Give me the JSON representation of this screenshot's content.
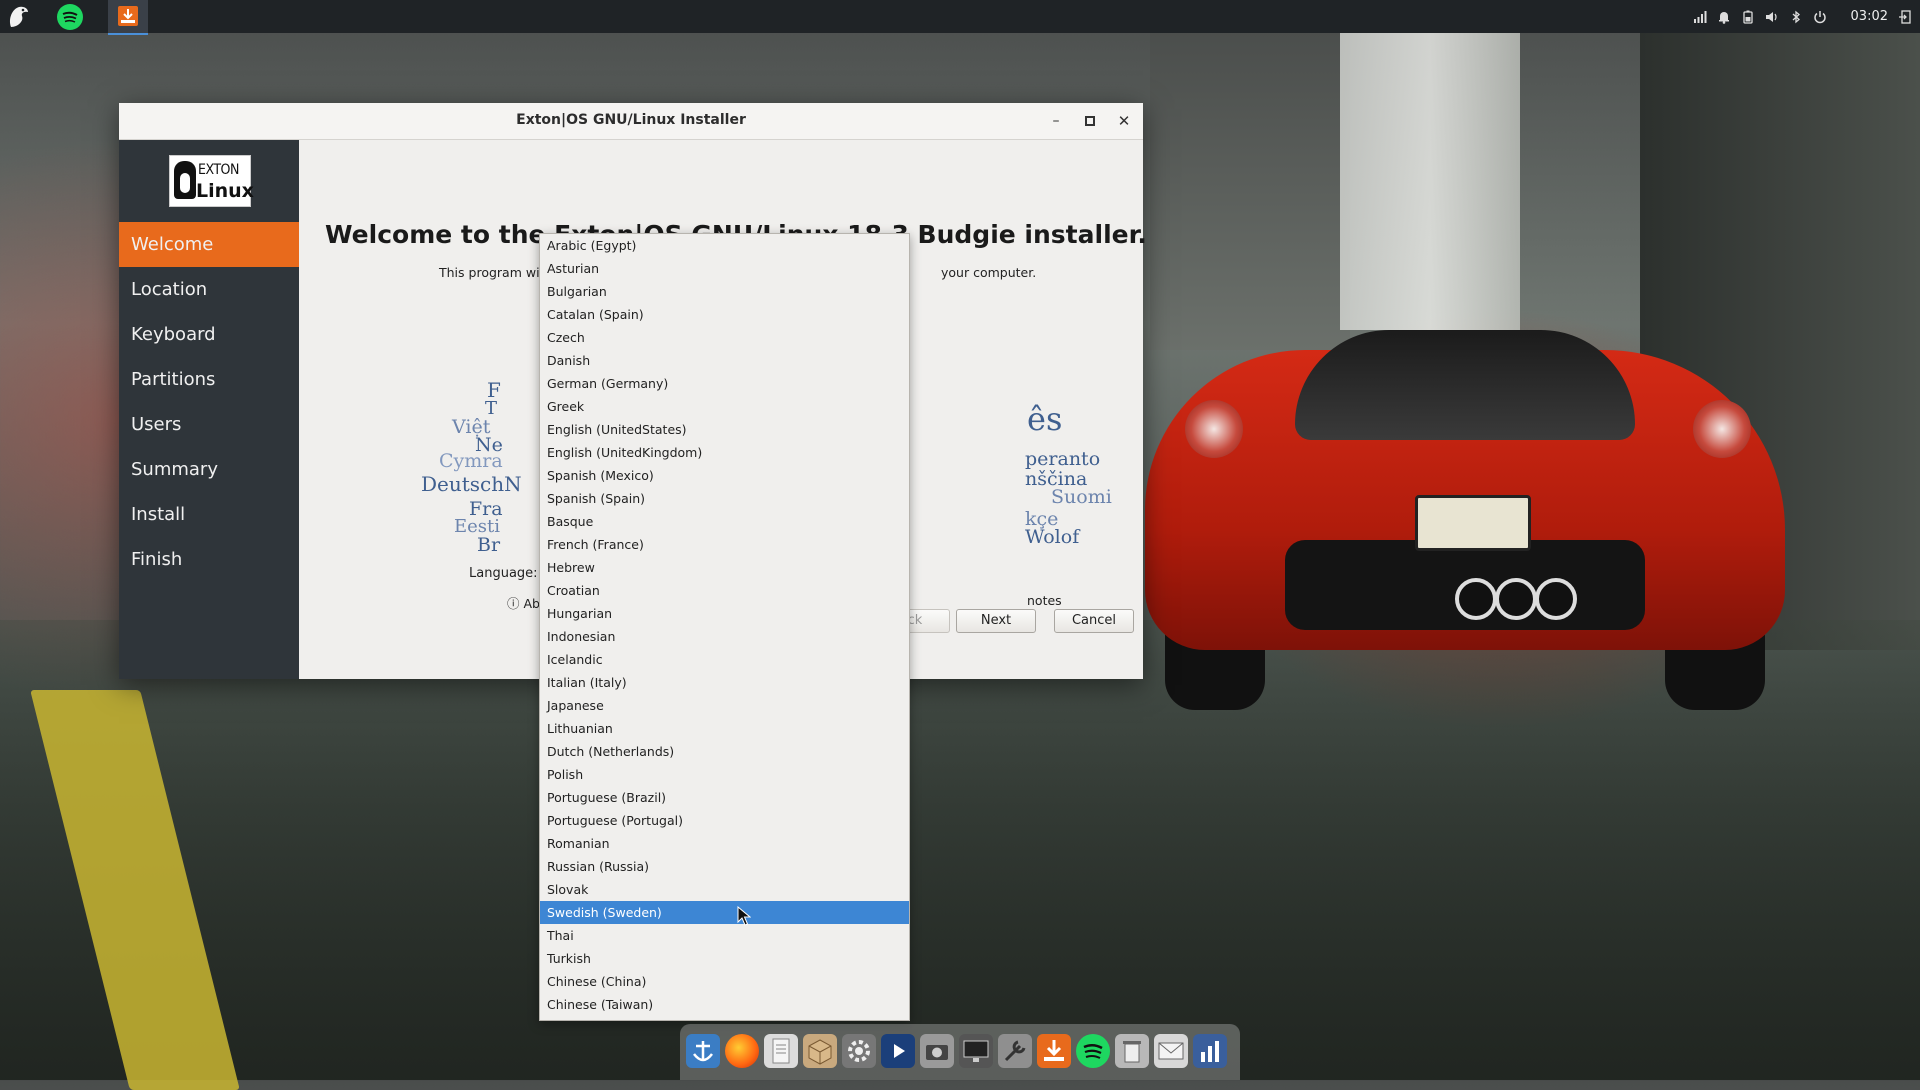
{
  "top_panel": {
    "clock": "03:02",
    "left_icons": [
      "budgie-menu-icon",
      "spotify-icon",
      "installer-icon"
    ],
    "tray_icons": [
      "signal-icon",
      "bell-icon",
      "battery-icon",
      "volume-icon",
      "bluetooth-icon",
      "power-icon",
      "logout-icon"
    ]
  },
  "window": {
    "title": "Exton|OS GNU/Linux Installer",
    "logo": {
      "line1": "EXTON",
      "line2": "Linux"
    },
    "sidebar": {
      "items": [
        {
          "label": "Welcome",
          "active": true
        },
        {
          "label": "Location"
        },
        {
          "label": "Keyboard"
        },
        {
          "label": "Partitions"
        },
        {
          "label": "Users"
        },
        {
          "label": "Summary"
        },
        {
          "label": "Install"
        },
        {
          "label": "Finish"
        }
      ]
    },
    "main": {
      "heading": "Welcome to the Exton|OS GNU/Linux 18.3 Budgie installer.",
      "desc_left": "This program wi",
      "desc_right": "your computer.",
      "cloud_left": [
        "Việt",
        "Ne",
        "Cymra",
        "DeutschN",
        "Fra",
        "Eesti",
        "Br",
        "F",
        "T"
      ],
      "cloud_right": [
        "ês",
        "peranto",
        "nščina",
        "Suomi",
        "kçe",
        "Wolof"
      ],
      "language_label": "Language:",
      "about_text": "ⓘ Ab",
      "release_notes": "notes",
      "buttons": {
        "back": "ck",
        "next": "Next",
        "cancel": "Cancel"
      }
    }
  },
  "language_dropdown": {
    "selected": "Swedish (Sweden)",
    "options": [
      "Arabic (Egypt)",
      "Asturian",
      "Bulgarian",
      "Catalan (Spain)",
      "Czech",
      "Danish",
      "German (Germany)",
      "Greek",
      "English (UnitedStates)",
      "English (UnitedKingdom)",
      "Spanish (Mexico)",
      "Spanish (Spain)",
      "Basque",
      "French (France)",
      "Hebrew",
      "Croatian",
      "Hungarian",
      "Indonesian",
      "Icelandic",
      "Italian (Italy)",
      "Japanese",
      "Lithuanian",
      "Dutch (Netherlands)",
      "Polish",
      "Portuguese (Brazil)",
      "Portuguese (Portugal)",
      "Romanian",
      "Russian (Russia)",
      "Slovak",
      "Swedish (Sweden)",
      "Thai",
      "Turkish",
      "Chinese (China)",
      "Chinese (Taiwan)"
    ]
  },
  "dock": {
    "icons": [
      "anchor-icon",
      "firefox-icon",
      "files-icon",
      "package-icon",
      "settings-icon",
      "media-player-icon",
      "camera-icon",
      "monitor-icon",
      "tools-icon",
      "installer-icon",
      "spotify-icon",
      "trash-icon",
      "mail-icon",
      "system-monitor-icon"
    ]
  },
  "colors": {
    "accent_active": "#e86a1c",
    "selection": "#3d86d4",
    "sidebar_bg": "#2f353a"
  }
}
